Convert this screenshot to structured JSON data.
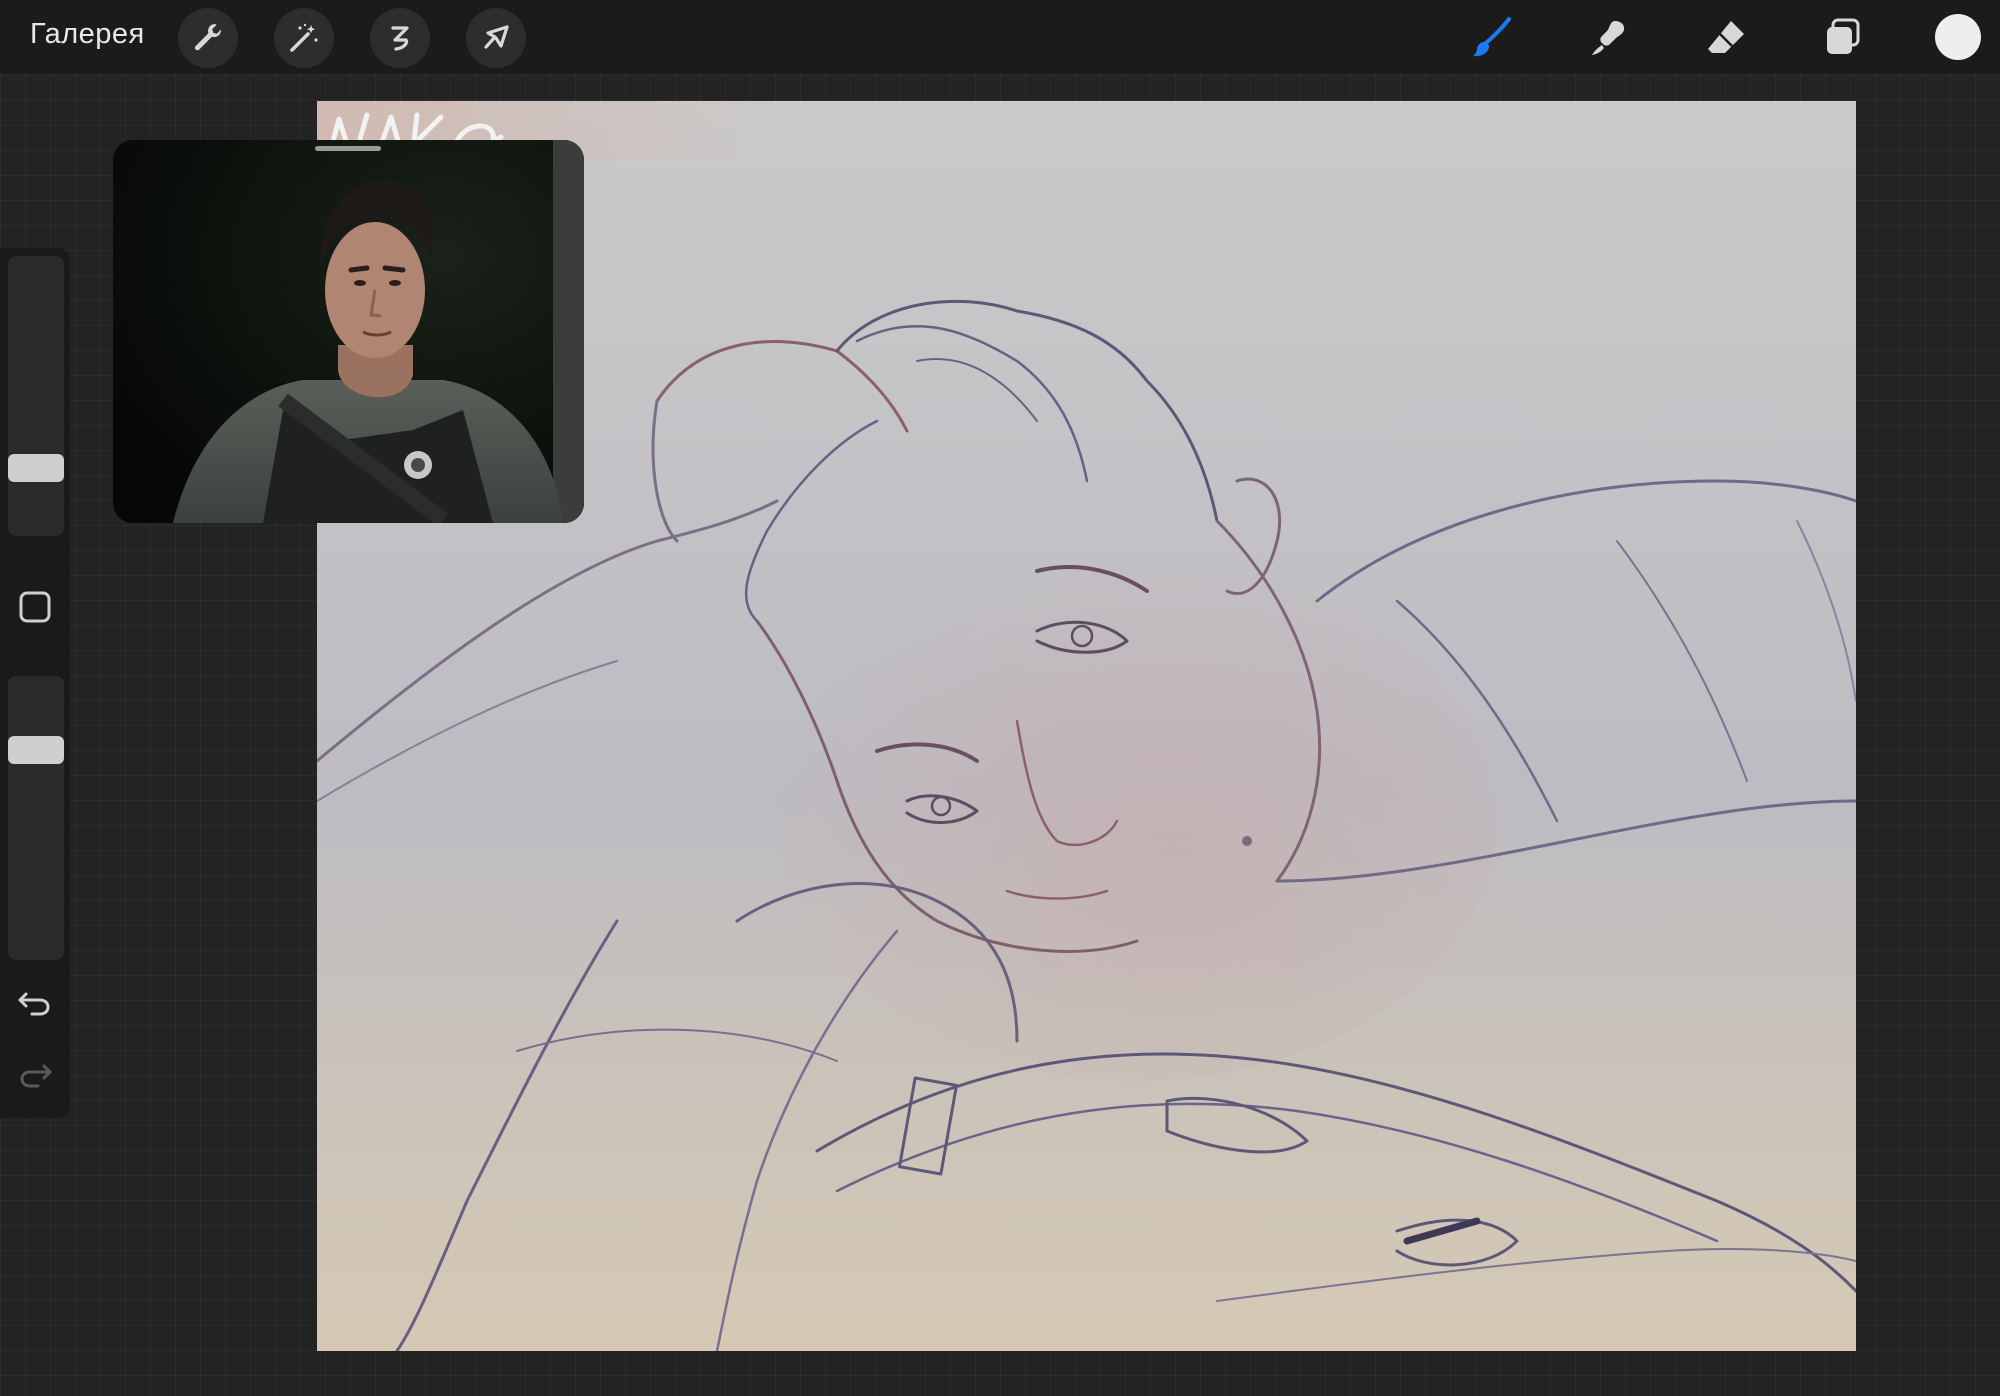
{
  "toolbar": {
    "gallery_label": "Галерея",
    "left_tools": [
      {
        "name": "wrench-icon",
        "action": "actions"
      },
      {
        "name": "magic-wand-icon",
        "action": "adjustments"
      },
      {
        "name": "selection-icon",
        "action": "selection"
      },
      {
        "name": "arrow-cursor-icon",
        "action": "transform"
      }
    ],
    "right_tools": [
      {
        "name": "brush-icon",
        "action": "paint",
        "active": true
      },
      {
        "name": "smudge-icon",
        "action": "smudge"
      },
      {
        "name": "eraser-icon",
        "action": "erase"
      },
      {
        "name": "layers-icon",
        "action": "layers"
      }
    ],
    "current_color": "#eeeeee",
    "accent": "#1a7cf2"
  },
  "sidebar": {
    "brush_size_level": 0.28,
    "opacity_level": 0.78,
    "undo_icon": "undo-icon",
    "redo_icon": "redo-icon",
    "modify_icon": "square-icon"
  },
  "reference": {
    "description_icon": "reference-photo"
  },
  "canvas": {
    "signature": "NAKO"
  }
}
